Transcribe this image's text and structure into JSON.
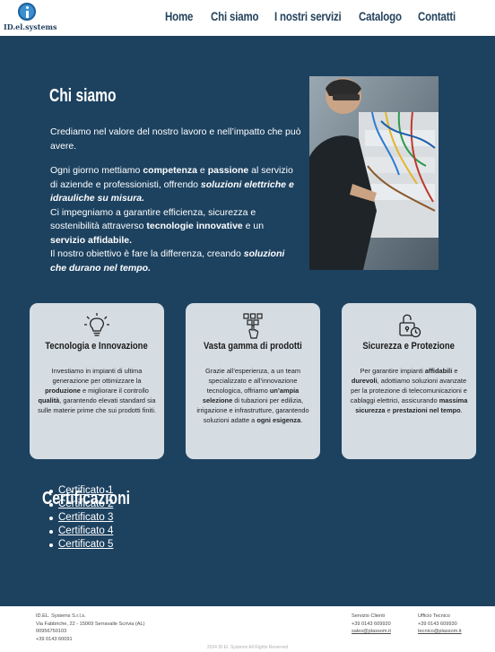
{
  "header": {
    "logo_text": "ID.el.systems",
    "nav": [
      "Home",
      "Chi siamo",
      "I nostri servizi",
      "Catalogo",
      "Contatti"
    ]
  },
  "about": {
    "title": "Chi siamo",
    "p1": "Crediamo nel valore del nostro lavoro e nell’impatto che può avere.",
    "p2_a": "Ogni giorno mettiamo ",
    "p2_b": "competenza",
    "p2_c": " e ",
    "p2_d": "passione",
    "p2_e": " al servizio di aziende e professionisti, offrendo ",
    "p2_f": "soluzioni elettriche e idrauliche su misura.",
    "p3_a": "Ci impegniamo a garantire efficienza, sicurezza e sostenibilità attraverso ",
    "p3_b": "tecnologie innovative",
    "p3_c": " e un ",
    "p3_d": "servizio affidabile.",
    "p4_a": "Il nostro obiettivo è fare la differenza, creando ",
    "p4_b": "soluzioni che durano nel tempo."
  },
  "cards": [
    {
      "icon": "lightbulb-icon",
      "title": "Tecnologia e Innovazione",
      "t1": "Investiamo in impianti di ultima generazione per ottimizzare la ",
      "b1": "produzione",
      "t2": " e migliorare il controllo ",
      "b2": "qualità",
      "t3": ", garantendo elevati standard sia sulle materie prime che sui prodotti finiti.",
      "b3": "",
      "t4": ""
    },
    {
      "icon": "products-icon",
      "title": "Vasta gamma di prodotti",
      "t1": "Grazie all’esperienza, a un team specializzato e all’innovazione tecnologica, offriamo ",
      "b1": "un’ampia selezione",
      "t2": " di tubazioni per edilizia, irrigazione e infrastrutture, garantendo soluzioni adatte a ",
      "b2": "ogni esigenza",
      "t3": ".",
      "b3": "",
      "t4": ""
    },
    {
      "icon": "lock-clock-icon",
      "title": "Sicurezza e Protezione",
      "t1": "Per garantire impianti ",
      "b1": "affidabili",
      "t2": " e ",
      "b2": "durevoli",
      "t3": ", adottiamo soluzioni avanzate per la protezione di telecomunicazioni e cablaggi elettrici, assicurando ",
      "b3": "massima sicurezza",
      "t4": " e ",
      "b4": "prestazioni nel tempo",
      "t5": "."
    }
  ],
  "certifications": {
    "title": "Certificazioni",
    "items": [
      "Certificato 1",
      "Certificato 2",
      "Certificato 3",
      "Certificato 4",
      "Certificato 5"
    ]
  },
  "footer": {
    "company": "ID.EL. Systems S.r.l.s.",
    "address": "Via Fabbriche, 22 - 15069 Serravalle Scrivia (AL)",
    "vat": "00956750103",
    "phone": "+39 0143 60091",
    "clients_title": "Servizio Clienti",
    "clients_phone": "+39 0143 609920",
    "clients_email": "sales@plassom.it",
    "tech_title": "Ufficio Tecnico",
    "tech_phone": "+39 0143 609930",
    "tech_email": "tecnico@plassom.it",
    "copyright": "2024 ID.El. Systems All Rights Reserved"
  }
}
